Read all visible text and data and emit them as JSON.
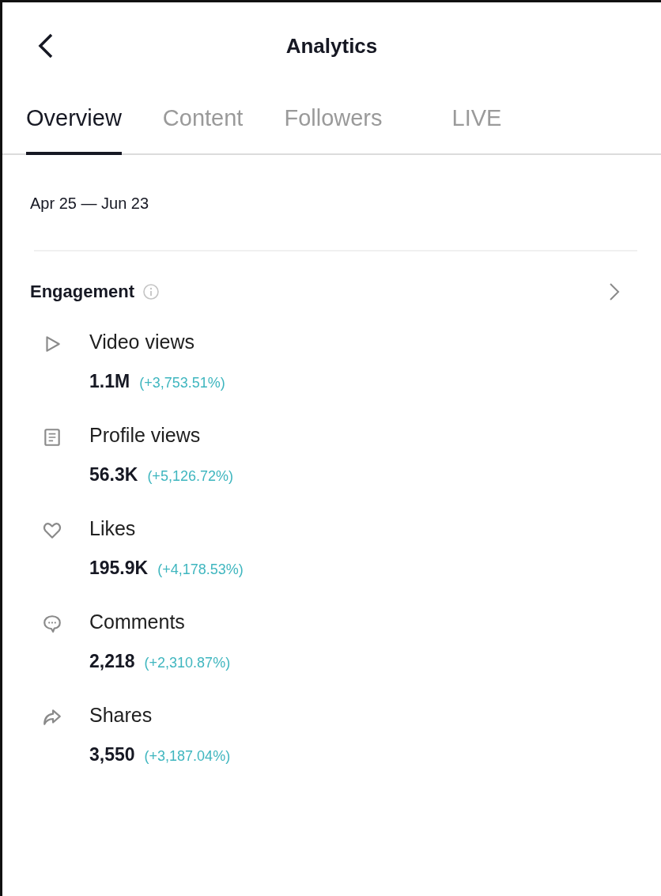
{
  "header": {
    "title": "Analytics"
  },
  "tabs": [
    {
      "label": "Overview",
      "selected": true
    },
    {
      "label": "Content",
      "selected": false
    },
    {
      "label": "Followers",
      "selected": false
    },
    {
      "label": "LIVE",
      "selected": false
    }
  ],
  "date_range": "Apr 25 — Jun 23",
  "section": {
    "title": "Engagement"
  },
  "metrics": [
    {
      "kind": "play",
      "label": "Video views",
      "value": "1.1M",
      "change": "(+3,753.51%)"
    },
    {
      "kind": "document",
      "label": "Profile views",
      "value": "56.3K",
      "change": "(+5,126.72%)"
    },
    {
      "kind": "heart",
      "label": "Likes",
      "value": "195.9K",
      "change": "(+4,178.53%)"
    },
    {
      "kind": "comment",
      "label": "Comments",
      "value": "2,218",
      "change": "(+2,310.87%)"
    },
    {
      "kind": "share",
      "label": "Shares",
      "value": "3,550",
      "change": "(+3,187.04%)"
    }
  ]
}
